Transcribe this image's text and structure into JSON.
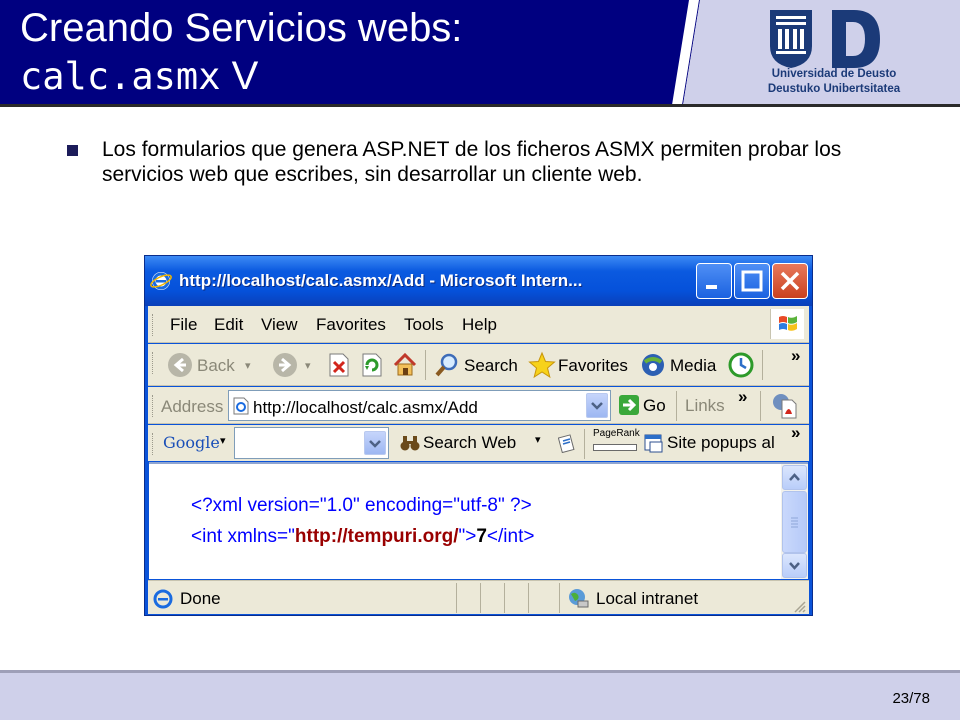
{
  "slide": {
    "title": "Creando Servicios webs:",
    "subtitle_code": "calc.asmx",
    "subtitle_suffix": "V",
    "logo_line1": "Universidad de Deusto",
    "logo_line2": "Deustuko Unibertsitatea",
    "bullet": "Los formularios que genera ASP.NET de los ficheros ASMX permiten probar los servicios web que escribes, sin desarrollar un cliente web.",
    "page_number": "23/78",
    "colors": {
      "header_blue": "#000080",
      "logo_blue": "#1b3a78",
      "footer": "#cfd0ea"
    }
  },
  "browser": {
    "window_title": "http://localhost/calc.asmx/Add - Microsoft Intern...",
    "menu": [
      "File",
      "Edit",
      "View",
      "Favorites",
      "Tools",
      "Help"
    ],
    "toolbar": {
      "back": "Back",
      "search": "Search",
      "favorites": "Favorites",
      "media": "Media",
      "more": "»"
    },
    "address": {
      "label": "Address",
      "url": "http://localhost/calc.asmx/Add",
      "go": "Go",
      "links": "Links",
      "more": "»"
    },
    "google": {
      "logo": "Google",
      "search_web": "Search Web",
      "pagerank": "PageRank",
      "popups": "Site popups al",
      "more": "»"
    },
    "content": {
      "line1": "<?xml version=\"1.0\" encoding=\"utf-8\" ?>",
      "line2_start": "<int xmlns=\"",
      "line2_ns": "http://tempuri.org/",
      "line2_mid": "\">",
      "line2_value": "7",
      "line2_end": "</int>"
    },
    "status": {
      "left": "Done",
      "zone": "Local intranet"
    }
  }
}
